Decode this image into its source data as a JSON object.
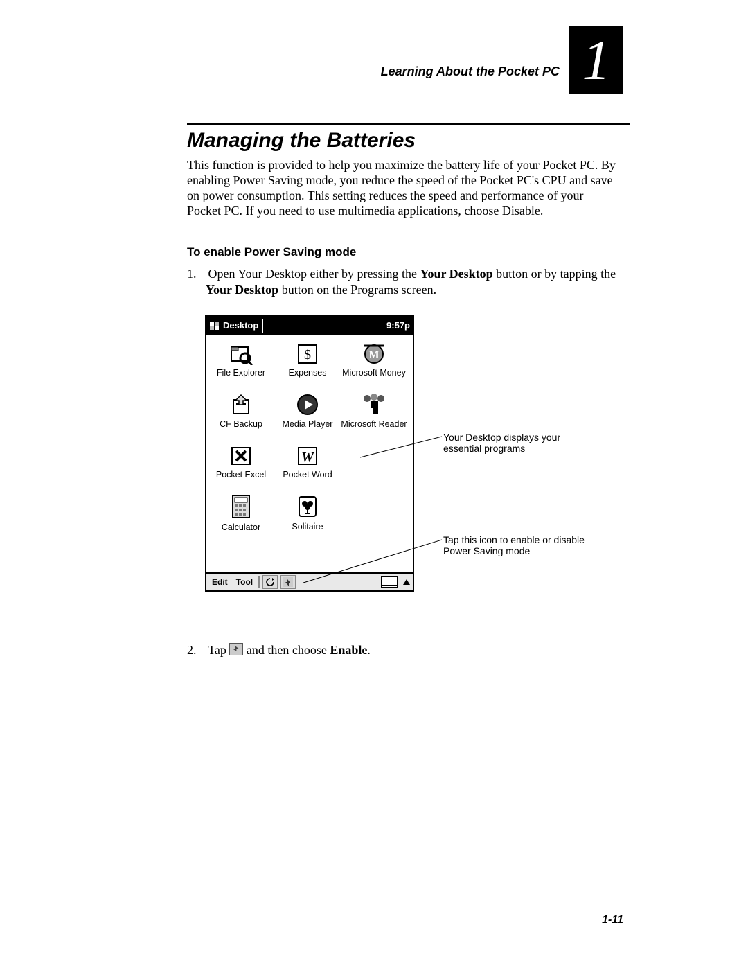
{
  "header": {
    "running": "Learning About the Pocket PC",
    "chapter_number": "1"
  },
  "section_title": "Managing the Batteries",
  "intro": "This function is provided to help you maximize the battery life of your Pocket PC. By enabling Power Saving mode, you reduce the speed of the Pocket PC's CPU and save on power consumption. This setting reduces the speed and performance of your Pocket PC. If you need to use multimedia applications, choose Disable.",
  "subhead": "To enable Power Saving mode",
  "steps": {
    "s1_num": "1.",
    "s1_a": "Open Your Desktop either by pressing the ",
    "s1_b": "Your Desktop",
    "s1_c": " button or by tapping the ",
    "s1_d": "Your Desktop",
    "s1_e": " button on the Programs screen.",
    "s2_num": "2.",
    "s2_a": "Tap ",
    "s2_b": " and then choose ",
    "s2_c": "Enable",
    "s2_d": "."
  },
  "ppc": {
    "title": "Desktop",
    "time": "9:57p",
    "menu_edit": "Edit",
    "menu_tool": "Tool",
    "grid": [
      [
        {
          "name": "file-explorer",
          "label": "File Explorer"
        },
        {
          "name": "expenses",
          "label": "Expenses"
        },
        {
          "name": "microsoft-money",
          "label": "Microsoft Money"
        }
      ],
      [
        {
          "name": "cf-backup",
          "label": "CF Backup"
        },
        {
          "name": "media-player",
          "label": "Media Player"
        },
        {
          "name": "microsoft-reader",
          "label": "Microsoft Reader"
        }
      ],
      [
        {
          "name": "pocket-excel",
          "label": "Pocket Excel"
        },
        {
          "name": "pocket-word",
          "label": "Pocket Word"
        }
      ],
      [
        {
          "name": "calculator",
          "label": "Calculator"
        },
        {
          "name": "solitaire",
          "label": "Solitaire"
        }
      ]
    ]
  },
  "callouts": {
    "c1": "Your Desktop displays your essential programs",
    "c2": "Tap this icon to enable or disable Power Saving mode"
  },
  "page_number": "1-11"
}
